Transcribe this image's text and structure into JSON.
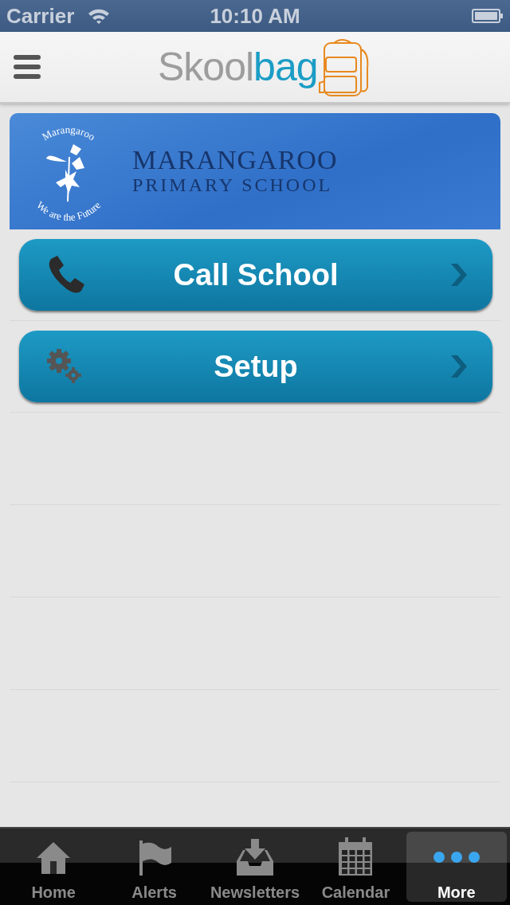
{
  "status_bar": {
    "carrier": "Carrier",
    "time": "10:10 AM"
  },
  "nav_bar": {
    "logo": {
      "part_1": "Skool",
      "part_2": "bag"
    }
  },
  "banner": {
    "emblem_top": "Marangaroo",
    "emblem_bottom": "We are the Future",
    "title": "MARANGAROO",
    "subtitle": "PRIMARY SCHOOL"
  },
  "menu": [
    {
      "kind": "phone",
      "label": "Call School"
    },
    {
      "kind": "gear",
      "label": "Setup"
    }
  ],
  "tab_bar": [
    {
      "kind": "home",
      "label": "Home",
      "selected": false
    },
    {
      "kind": "flag",
      "label": "Alerts",
      "selected": false
    },
    {
      "kind": "inbox",
      "label": "Newsletters",
      "selected": false
    },
    {
      "kind": "calendar",
      "label": "Calendar",
      "selected": false
    },
    {
      "kind": "more",
      "label": "More",
      "selected": true
    }
  ]
}
